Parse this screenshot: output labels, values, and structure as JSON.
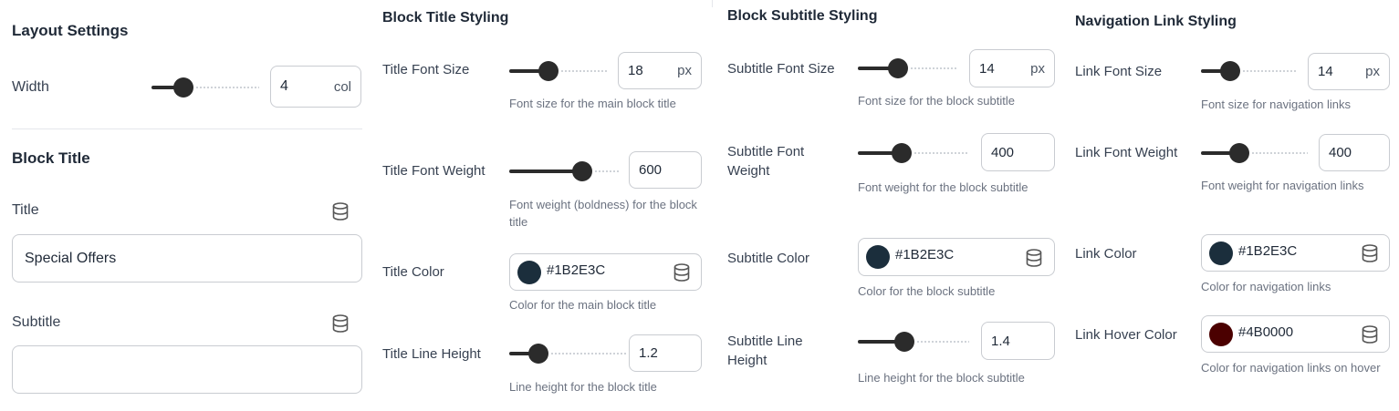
{
  "layout": {
    "title": "Layout Settings",
    "width_label": "Width",
    "width_value": "4",
    "width_unit": "col",
    "width_fraction": 0.3
  },
  "block_title": {
    "heading": "Block Title",
    "title_label": "Title",
    "title_value": "Special Offers",
    "subtitle_label": "Subtitle",
    "subtitle_value": ""
  },
  "title_styling": {
    "heading": "Block Title Styling",
    "font_size": {
      "label": "Title Font Size",
      "value": "18",
      "unit": "px",
      "help": "Font size for the main block title",
      "fraction": 0.4
    },
    "font_weight": {
      "label": "Title Font Weight",
      "value": "600",
      "help": "Font weight (boldness) for the block title",
      "fraction": 0.67
    },
    "color": {
      "label": "Title Color",
      "value": "#1B2E3C",
      "swatch": "#1B2E3C",
      "help": "Color for the main block title",
      "icon": "database-icon"
    },
    "line_height": {
      "label": "Title Line Height",
      "value": "1.2",
      "help": "Line height for the block title",
      "fraction": 0.25
    }
  },
  "subtitle_styling": {
    "heading": "Block Subtitle Styling",
    "font_size": {
      "label": "Subtitle Font Size",
      "value": "14",
      "unit": "px",
      "help": "Font size for the block subtitle",
      "fraction": 0.4
    },
    "font_weight": {
      "label": "Subtitle Font Weight",
      "value": "400",
      "help": "Font weight for the block subtitle",
      "fraction": 0.4
    },
    "color": {
      "label": "Subtitle Color",
      "value": "#1B2E3C",
      "swatch": "#1B2E3C",
      "help": "Color for the block subtitle",
      "icon": "database-icon"
    },
    "line_height": {
      "label": "Subtitle Line Height",
      "value": "1.4",
      "help": "Line height for the block subtitle",
      "fraction": 0.42
    }
  },
  "link_styling": {
    "heading": "Navigation Link Styling",
    "font_size": {
      "label": "Link Font Size",
      "value": "14",
      "unit": "px",
      "help": "Font size for navigation links",
      "fraction": 0.3
    },
    "font_weight": {
      "label": "Link Font Weight",
      "value": "400",
      "help": "Font weight for navigation links",
      "fraction": 0.36
    },
    "color": {
      "label": "Link Color",
      "value": "#1B2E3C",
      "swatch": "#1B2E3C",
      "help": "Color for navigation links",
      "icon": "database-icon"
    },
    "hover_color": {
      "label": "Link Hover Color",
      "value": "#4B0000",
      "swatch": "#4B0000",
      "help": "Color for navigation links on hover",
      "icon": "database-icon"
    }
  }
}
